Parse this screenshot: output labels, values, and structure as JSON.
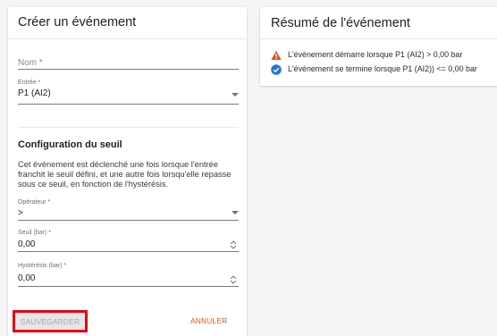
{
  "create_card": {
    "title": "Créer un événement",
    "name_field": {
      "placeholder": "Nom *",
      "value": ""
    },
    "input_field": {
      "label": "Entrée *",
      "value": "P1 (AI2)"
    },
    "threshold": {
      "title": "Configuration du seuil",
      "description": "Cet événement est déclenché une fois lorsque l'entrée franchit le seuil défini, et une autre fois lorsqu'elle repasse sous ce seuil, en fonction de l'hystérésis.",
      "operator": {
        "label": "Opérateur *",
        "value": ">"
      },
      "threshold_value": {
        "label": "Seuil (bar) *",
        "value": "0,00"
      },
      "hysteresis": {
        "label": "Hystérésis (bar) *",
        "value": "0,00"
      }
    },
    "save_label": "SAUVEGARDER",
    "cancel_label": "ANNULER"
  },
  "summary_card": {
    "title": "Résumé de l'événement",
    "items": [
      {
        "icon": "warning-icon",
        "color": "#e8501a",
        "text": "L'événement démarre lorsque P1 (AI2) > 0,00 bar"
      },
      {
        "icon": "check-circle-icon",
        "color": "#1e78d6",
        "text": "L'événement se termine lorsque P1 (AI2)) <= 0,00 bar"
      }
    ]
  },
  "colors": {
    "accent": "#e8501a",
    "info": "#1e78d6",
    "highlight_border": "#e5000f"
  }
}
